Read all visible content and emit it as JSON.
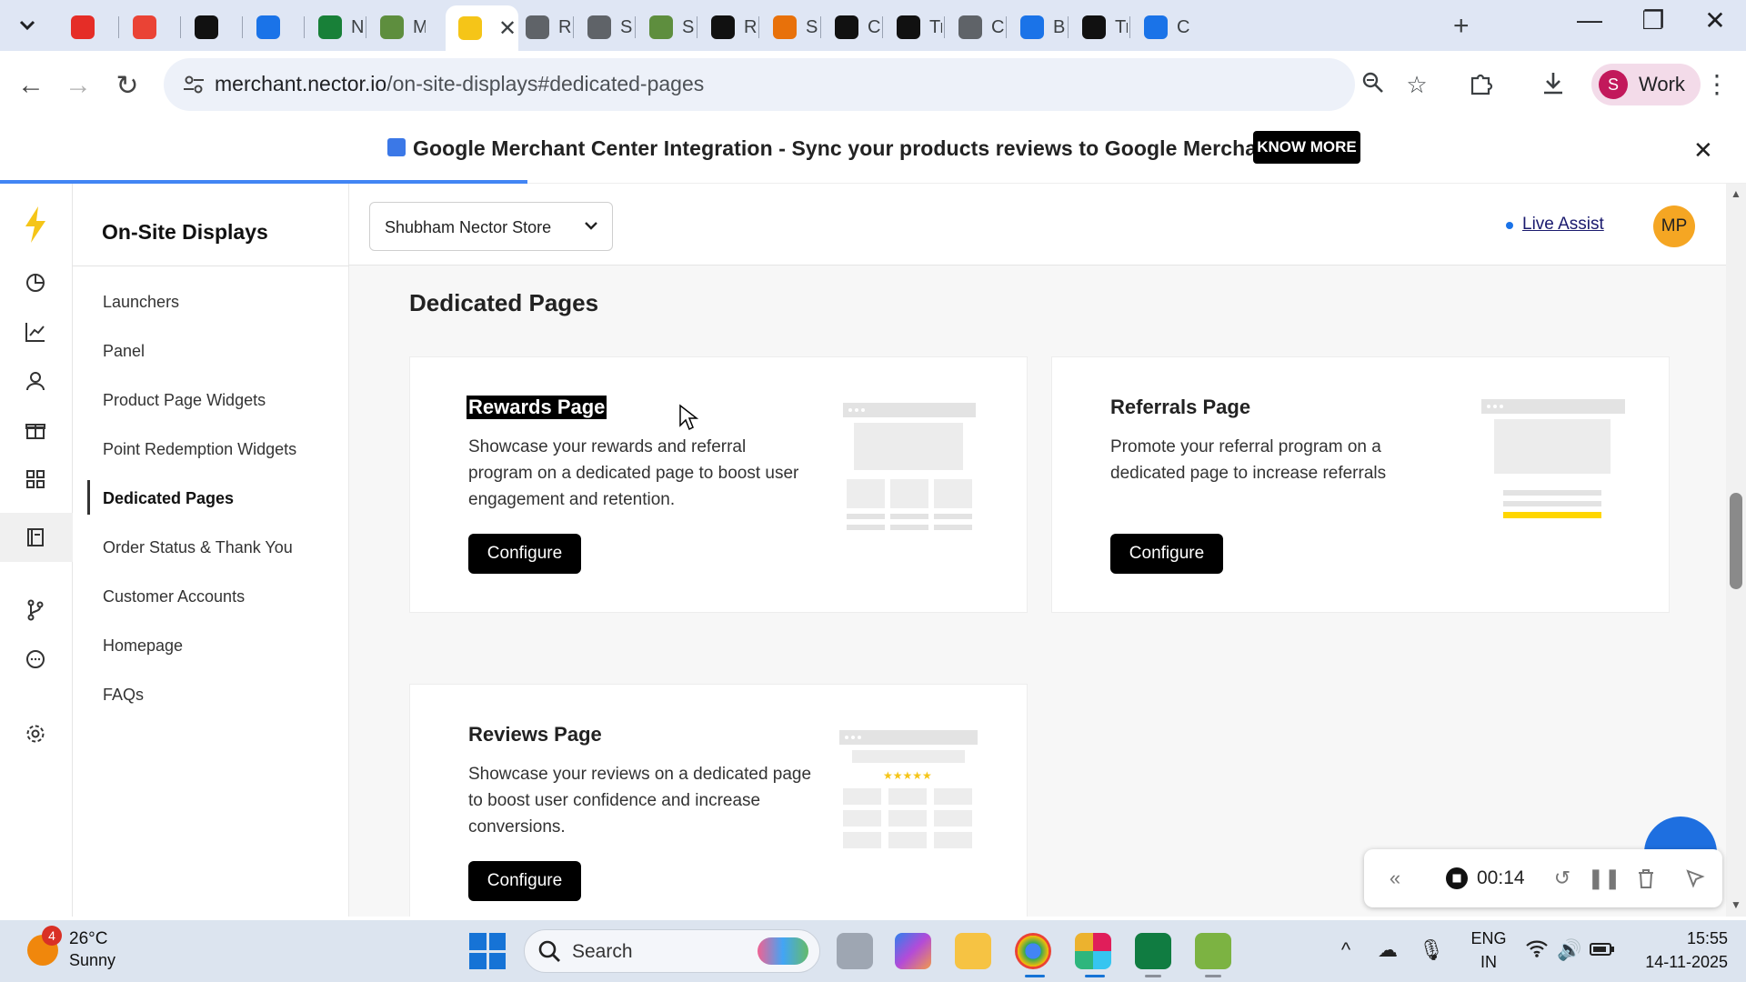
{
  "browser": {
    "tabs": [
      {
        "label": "",
        "color": "#e52d27"
      },
      {
        "label": "",
        "color": "#ea4335"
      },
      {
        "label": "",
        "color": "#111111"
      },
      {
        "label": "",
        "color": "#1a73e8"
      },
      {
        "label": "Ne",
        "color": "#188038"
      },
      {
        "label": "M",
        "color": "#5e8e3e"
      },
      {
        "label": "",
        "color": "#f5c518",
        "active": true
      },
      {
        "label": "Re",
        "color": "#5f6368"
      },
      {
        "label": "Sh",
        "color": "#5f6368"
      },
      {
        "label": "Sh",
        "color": "#5e8e3e"
      },
      {
        "label": "Re",
        "color": "#111111"
      },
      {
        "label": "Sh",
        "color": "#e8710a"
      },
      {
        "label": "Ca",
        "color": "#111111"
      },
      {
        "label": "Tr",
        "color": "#111111"
      },
      {
        "label": "Co",
        "color": "#5f6368"
      },
      {
        "label": "Bc",
        "color": "#1a73e8"
      },
      {
        "label": "Tr",
        "color": "#111111"
      },
      {
        "label": "Cu",
        "color": "#1a73e8"
      }
    ],
    "url_host": "merchant.nector.io",
    "url_path": "/on-site-displays#dedicated-pages",
    "profile_initial": "S",
    "profile_name": "Work"
  },
  "banner": {
    "text": "Google Merchant Center Integration - Sync your products reviews to Google Merchant Center",
    "button": "KNOW MORE"
  },
  "subnav": {
    "title": "On-Site Displays",
    "items": [
      "Launchers",
      "Panel",
      "Product Page Widgets",
      "Point Redemption Widgets",
      "Dedicated Pages",
      "Order Status & Thank You",
      "Customer Accounts",
      "Homepage",
      "FAQs"
    ],
    "active_index": 4
  },
  "topbar": {
    "store": "Shubham Nector Store",
    "live_assist": "Live Assist",
    "avatar": "MP"
  },
  "content": {
    "title": "Dedicated Pages",
    "cards": [
      {
        "title": "Rewards Page",
        "desc": "Showcase your rewards and referral program on a dedicated page to boost user engagement and retention.",
        "button": "Configure"
      },
      {
        "title": "Referrals Page",
        "desc": "Promote your referral program on a dedicated page to increase referrals",
        "button": "Configure"
      },
      {
        "title": "Reviews Page",
        "desc": "Showcase your reviews on a dedicated page to boost user confidence and increase conversions.",
        "button": "Configure"
      }
    ]
  },
  "recorder": {
    "time": "00:14"
  },
  "taskbar": {
    "weather_badge": "4",
    "temp": "26°C",
    "condition": "Sunny",
    "search": "Search",
    "lang1": "ENG",
    "lang2": "IN",
    "time": "15:55",
    "date": "14-11-2025"
  },
  "colors": {
    "accent_bolt": "#f5c518",
    "primary_button": "#000000",
    "avatar_bg": "#f5a623",
    "highlight_line": "#ffd600"
  }
}
